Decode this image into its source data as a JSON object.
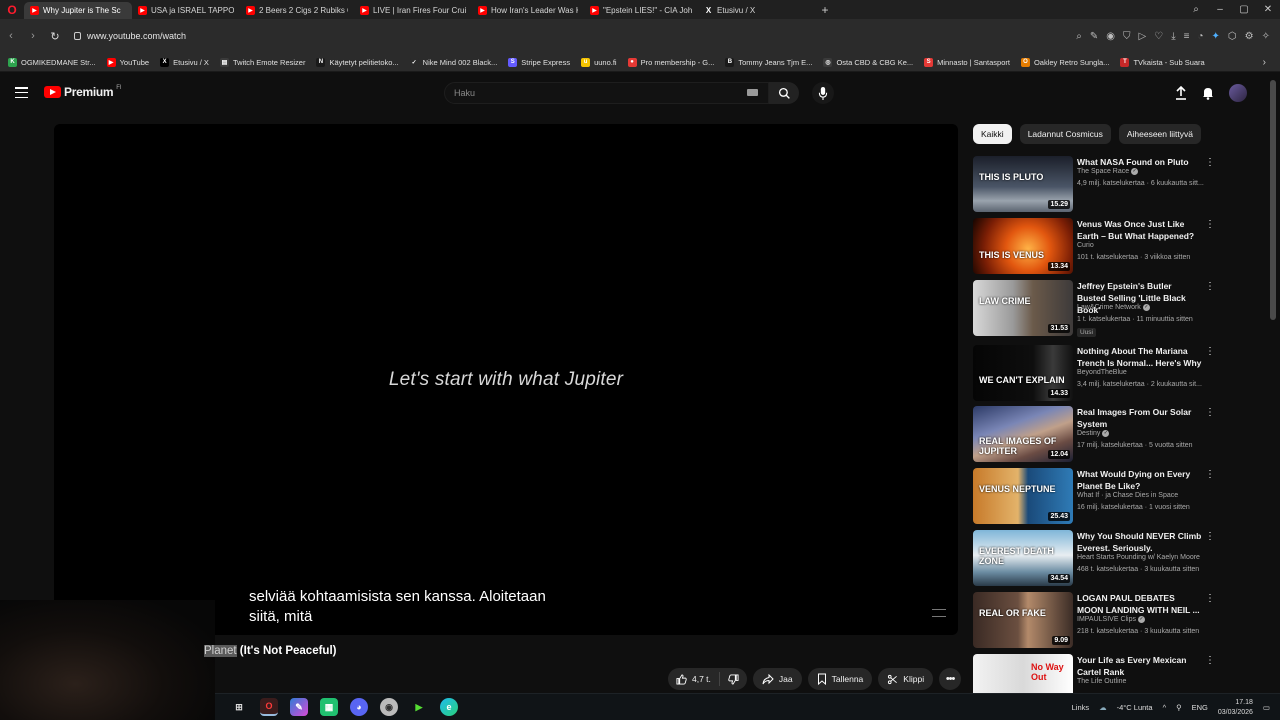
{
  "browser": {
    "tabs": [
      {
        "label": "Why Jupiter is The Sc",
        "active": true
      },
      {
        "label": "USA ja ISRAEL TAPPOIVAT"
      },
      {
        "label": "2 Beers 2 Cigs 2 Rubiks Cu"
      },
      {
        "label": "LIVE | Iran Fires Four Cruis"
      },
      {
        "label": "How Iran's Leader Was Kil"
      },
      {
        "label": "\"Epstein LIES!\" - CIA John"
      },
      {
        "label": "Etusivu / X"
      }
    ],
    "new_tab": "+",
    "url": "www.youtube.com/watch",
    "bookmarks": [
      {
        "label": "OGMIKEDMANE Str...",
        "color": "#2ea44f",
        "glyph": "K"
      },
      {
        "label": "YouTube",
        "color": "#ff0000",
        "glyph": "▶"
      },
      {
        "label": "Etusivu / X",
        "color": "#000000",
        "glyph": "X"
      },
      {
        "label": "Twitch Emote Resizer",
        "color": "#3a3a3a",
        "glyph": "▤"
      },
      {
        "label": "Käytetyt pelitietoko...",
        "color": "#1a1a1a",
        "glyph": "N"
      },
      {
        "label": "Nike Mind 002 Black...",
        "color": "#2b2b2b",
        "glyph": "✓"
      },
      {
        "label": "Stripe Express",
        "color": "#635bff",
        "glyph": "S"
      },
      {
        "label": "uuno.fi",
        "color": "#f5c400",
        "glyph": "u"
      },
      {
        "label": "Pro membership - G...",
        "color": "#e53935",
        "glyph": "●"
      },
      {
        "label": "Tommy Jeans Tjm E...",
        "color": "#1a1a1a",
        "glyph": "B"
      },
      {
        "label": "Osta CBD & CBG Ke...",
        "color": "#3a3a3a",
        "glyph": "◎"
      },
      {
        "label": "Minnasto | Santasport",
        "color": "#e53935",
        "glyph": "S"
      },
      {
        "label": "Oakley Retro Sungla...",
        "color": "#e57c00",
        "glyph": "O"
      },
      {
        "label": "TVkaista - Sub Suara",
        "color": "#c62828",
        "glyph": "T"
      }
    ]
  },
  "youtube": {
    "logo_label": "Premium",
    "country_code": "FI",
    "search_placeholder": "Haku"
  },
  "player": {
    "center_caption": "Let's start with what Jupiter",
    "subtitle": "selviää kohtaamisista sen kanssa.  Aloitetaan\nsiitä, mitä"
  },
  "video": {
    "title_highlight": "Planet",
    "title_rest": " (It's Not Peaceful)",
    "like_count": "4,7 t.",
    "share_label": "Jaa",
    "save_label": "Tallenna",
    "clip_label": "Klippi"
  },
  "chips": [
    "Kaikki",
    "Ladannut Cosmicus",
    "Aiheeseen liittyvä"
  ],
  "recommendations": [
    {
      "title": "What NASA Found on Pluto",
      "channel": "The Space Race",
      "verified": true,
      "meta": "4,9 milj. katselukertaa · 6 kuukautta sitt...",
      "duration": "15.29",
      "thumb_text": "THIS IS PLUTO",
      "bg": "linear-gradient(180deg,#1b1f2a 0%,#4a5566 55%,#9aa3ad 80%,#5b6470 100%)"
    },
    {
      "title": "Venus Was Once Just Like Earth – But What Happened?",
      "channel": "Curio",
      "verified": false,
      "meta": "101 t. katselukertaa · 3 viikkoa sitten",
      "duration": "13.34",
      "thumb_text": "THIS IS VENUS",
      "bg": "radial-gradient(circle at 55% 55%,#ffb347 0%,#e2570f 35%,#7a1e05 70%,#140400 100%)"
    },
    {
      "title": "Jeffrey Epstein's Butler Busted Selling 'Little Black Book'",
      "channel": "Law&Crime Network",
      "verified": true,
      "meta": "1 t. katselukertaa · 11 minuuttia sitten",
      "duration": "31.53",
      "thumb_text": "LAW CRIME",
      "bg": "linear-gradient(90deg,#d8d8d8 0%,#9a9a9a 40%,#6b5a4a 60%,#3d3a3a 100%)",
      "badge": "Uusi"
    },
    {
      "title": "Nothing About The Mariana Trench Is Normal... Here's Why",
      "channel": "BeyondTheBlue",
      "verified": false,
      "meta": "3,4 milj. katselukertaa · 2 kuukautta sit...",
      "duration": "14.33",
      "thumb_text": "WE CAN'T EXPLAIN",
      "bg": "linear-gradient(90deg,#050505 0%,#0e0e0e 60%,#3a3a3a 80%,#111 100%)"
    },
    {
      "title": "Real Images From Our Solar System",
      "channel": "Destiny",
      "verified": true,
      "meta": "17 milj. katselukertaa · 5 vuotta sitten",
      "duration": "12.04",
      "thumb_text": "REAL IMAGES OF JUPITER",
      "bg": "linear-gradient(160deg,#2c3a66 0%,#7a86b6 35%,#c0a08a 55%,#6b4c44 75%,#1b1f33 100%)"
    },
    {
      "title": "What Would Dying on Every Planet Be Like?",
      "channel": "What If · ja Chase Dies in Space",
      "verified": false,
      "meta": "16 milj. katselukertaa · 1 vuosi sitten",
      "duration": "25.43",
      "thumb_text": "VENUS   NEPTUNE",
      "bg": "linear-gradient(90deg,#c77a2a 0%,#e3b36a 45%,#1a4a7a 55%,#2f7bb6 100%)"
    },
    {
      "title": "Why You Should NEVER Climb Everest. Seriously.",
      "channel": "Heart Starts Pounding w/ Kaelyn Moore",
      "verified": false,
      "meta": "468 t. katselukertaa · 3 kuukautta sitten",
      "duration": "34.54",
      "thumb_text": "EVEREST DEATH ZONE",
      "bg": "linear-gradient(180deg,#7fb6d8 0%,#e8eef2 45%,#6c8da3 75%,#2a3a48 100%)"
    },
    {
      "title": "LOGAN PAUL DEBATES MOON LANDING WITH NEIL ...",
      "channel": "IMPAULSIVE Clips",
      "verified": true,
      "meta": "218 t. katselukertaa · 3 kuukautta sitten",
      "duration": "9.09",
      "thumb_text": "REAL OR FAKE",
      "bg": "linear-gradient(90deg,#3a2a24 0%,#6b4f40 45%,#b38a6a 55%,#3b2c26 100%)"
    },
    {
      "title": "Your Life as Every Mexican Cartel Rank",
      "channel": "The Life Outline",
      "verified": false,
      "meta": "",
      "duration": "",
      "thumb_text": "No Way Out",
      "bg": "linear-gradient(90deg,#f2f2f2 0%,#d9d9d9 50%,#ffffff 100%)"
    }
  ],
  "taskbar": {
    "links_label": "Links",
    "weather": "-4°C Lunta",
    "language": "ENG",
    "time": "17.18",
    "date": "03/03/2026"
  }
}
